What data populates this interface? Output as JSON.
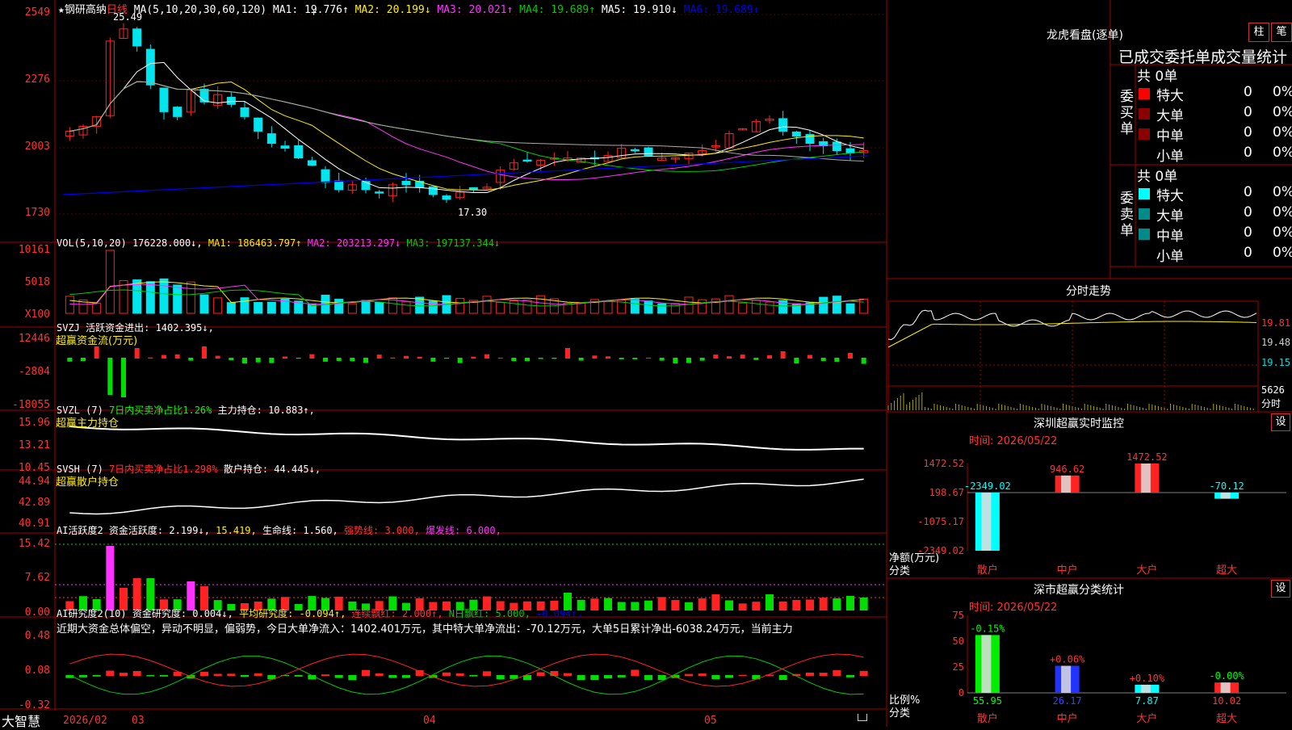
{
  "app": {
    "brand": "大智慧"
  },
  "colors": {
    "up": "#ff2222",
    "down": "#00e5ee",
    "grid": "#a00000",
    "ma1": "#ffffff",
    "ma2": "#ffee00",
    "ma3": "#ff33ff",
    "ma4": "#00cc00",
    "ma5": "#aaaaaa",
    "ma6": "#0000ee"
  },
  "kline": {
    "star": "★",
    "name": "钢研高纳",
    "period": "日线",
    "ma_prefix": "MA(5,10,20,30,60,120)",
    "ma": [
      {
        "label": "MA1: 19.776↑",
        "color": "#ffffff"
      },
      {
        "label": "MA2: 20.199↓",
        "color": "#ffee00"
      },
      {
        "label": "MA3: 20.021↑",
        "color": "#ff33ff"
      },
      {
        "label": "MA4: 19.689↑",
        "color": "#00cc00"
      },
      {
        "label": "MA5: 19.910↓",
        "color": "#ffffff"
      },
      {
        "label": "MA6: 19.689↑",
        "color": "#0000ee"
      }
    ],
    "yticks": [
      "2549",
      "2276",
      "2003",
      "1730"
    ],
    "high_label": "25.49",
    "low_label": "17.30",
    "cursor": "+"
  },
  "vol": {
    "title": "VOL(5,10,20)",
    "value": "176228.000↓",
    "ma": [
      {
        "label": "MA1: 186463.797↑",
        "color": "#ffee00"
      },
      {
        "label": "MA2: 203213.297↓",
        "color": "#ff33ff"
      },
      {
        "label": "MA3: 197137.344↓",
        "color": "#00cc00"
      }
    ],
    "yticks": [
      "10161",
      "5018",
      "X100"
    ]
  },
  "svzj": {
    "title": "SVZJ  活跃资金进出: 1402.395↓,",
    "subtitle": "超赢资金流(万元)",
    "yticks": [
      "12446",
      "-2804",
      "-18055"
    ]
  },
  "svzl": {
    "title": "SVZL (7)",
    "green": "7日内买卖净占比1.26%",
    "white": "主力持仓: 10.883↑,",
    "subtitle": "超赢主力持仓",
    "yticks": [
      "15.96",
      "13.21",
      "10.45"
    ]
  },
  "svsh": {
    "title": "SVSH (7)",
    "red": "7日内买卖净占比1.298%",
    "white": "散户持仓: 44.445↓,",
    "subtitle": "超赢散户持仓",
    "yticks": [
      "44.94",
      "42.89",
      "40.91"
    ]
  },
  "ai_active": {
    "title": "AI活跃度2",
    "parts": [
      {
        "t": "资金活跃度: 2.199↓,",
        "c": "#ffffff"
      },
      {
        "t": "15.419,",
        "c": "#ffee00"
      },
      {
        "t": "生命线: 1.560,",
        "c": "#ffffff"
      },
      {
        "t": "强势线: 3.000,",
        "c": "#ff3333"
      },
      {
        "t": "爆发线: 6.000,",
        "c": "#ff33ff"
      }
    ],
    "yticks": [
      "15.42",
      "7.62",
      "0.00"
    ]
  },
  "ai_research": {
    "title": "AI研究度2(10)",
    "parts": [
      {
        "t": "资金研究度: 0.004↓,",
        "c": "#ffffff"
      },
      {
        "t": "平均研究度: -0.094↑,",
        "c": "#ffee00"
      },
      {
        "t": "连续飘红: 2.000↑,",
        "c": "#ff3333"
      },
      {
        "t": "N日飘红: 5.000,",
        "c": "#00cc00"
      },
      {
        "t": "-0.094↑,",
        "c": "#0000ee"
      }
    ],
    "comment": "近期大资金总体偏空，异动不明显，偏弱势，今日大单净流入：1402.401万元，其中特大单净流出：-70.12万元，大单5日累计净出-6038.24万元，当前主力",
    "yticks": [
      "0.48",
      "0.08",
      "-0.32"
    ]
  },
  "xaxis": [
    "2026/02",
    "03",
    "04",
    "05"
  ],
  "longhu": {
    "title": "龙虎看盘(逐单)",
    "btn_col": "柱",
    "btn_pen": "笔",
    "header": "已成交委托单成交量统计",
    "buy_label": "委买单",
    "sell_label": "委卖单",
    "buy_total": "共 0单",
    "sell_total": "共 0单",
    "buy_rows": [
      {
        "name": "特大",
        "val": "0",
        "pct": "0%",
        "color": "#ff0000"
      },
      {
        "name": "大单",
        "val": "0",
        "pct": "0%",
        "color": "#8b0000"
      },
      {
        "name": "中单",
        "val": "0",
        "pct": "0%",
        "color": "#8b0000"
      },
      {
        "name": "小单",
        "val": "0",
        "pct": "0%",
        "color": ""
      }
    ],
    "sell_rows": [
      {
        "name": "特大",
        "val": "0",
        "pct": "0%",
        "color": "#00ffff"
      },
      {
        "name": "大单",
        "val": "0",
        "pct": "0%",
        "color": "#008b8b"
      },
      {
        "name": "中单",
        "val": "0",
        "pct": "0%",
        "color": "#008b8b"
      },
      {
        "name": "小单",
        "val": "0",
        "pct": "0%",
        "color": ""
      }
    ]
  },
  "intraday": {
    "title": "分时走势",
    "yticks": [
      "19.81",
      "19.48",
      "19.15"
    ],
    "vol_label": "5626",
    "vol_label2": "分时"
  },
  "sz_monitor": {
    "title": "深圳超赢实时监控",
    "settings": "设",
    "time": "时间: 2026/05/22",
    "yticks": [
      "1472.52",
      "198.67",
      "-1075.17",
      "-2349.02"
    ],
    "ylabel1": "净额(万元)",
    "ylabel2": "分类",
    "bars": [
      {
        "cat": "散户",
        "value": -2349.02,
        "label": "-2349.02",
        "color": "#00ffff"
      },
      {
        "cat": "中户",
        "value": 946.62,
        "label": "946.62",
        "color": "#ff2222"
      },
      {
        "cat": "大户",
        "value": 1472.52,
        "label": "1472.52",
        "color": "#ff2222"
      },
      {
        "cat": "超大",
        "value": -70.12,
        "label": "-70.12",
        "color": "#00ffff"
      }
    ]
  },
  "sz_class": {
    "title": "深市超赢分类统计",
    "settings": "设",
    "time": "时间: 2026/05/22",
    "yticks": [
      "75",
      "50",
      "25",
      "0"
    ],
    "ylabel1": "比例%",
    "ylabel2": "分类",
    "bars": [
      {
        "cat": "散户",
        "value": 55.95,
        "label": "55.95",
        "delta": "-0.15%",
        "delta_color": "#00ff00",
        "color": "#00ee00"
      },
      {
        "cat": "中户",
        "value": 26.17,
        "label": "26.17",
        "delta": "+0.06%",
        "delta_color": "#ff3333",
        "color": "#2233ff"
      },
      {
        "cat": "大户",
        "value": 7.87,
        "label": "7.87",
        "delta": "+0.10%",
        "delta_color": "#ff3333",
        "color": "#00ffff"
      },
      {
        "cat": "超大",
        "value": 10.02,
        "label": "10.02",
        "delta": "-0.00%",
        "delta_color": "#00ff00",
        "color": "#ff2222"
      }
    ]
  }
}
